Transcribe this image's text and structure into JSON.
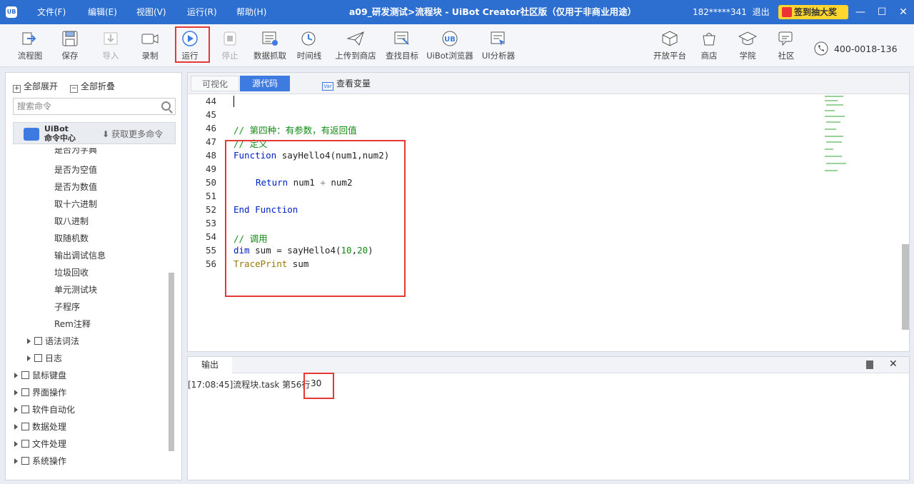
{
  "titlebar": {
    "logo": "UB",
    "menus": [
      "文件(F)",
      "编辑(E)",
      "视图(V)",
      "运行(R)",
      "帮助(H)"
    ],
    "title": "a09_研发测试>流程块 - UiBot Creator社区版（仅用于非商业用途）",
    "user": "182*****341",
    "logout": "退出",
    "promo": "签到抽大奖",
    "controls": [
      "—",
      "☐",
      "✕"
    ]
  },
  "toolbar": {
    "buttons": [
      {
        "label": "流程图",
        "icon": "flowchart-icon"
      },
      {
        "label": "保存",
        "icon": "save-icon"
      },
      {
        "label": "导入",
        "icon": "import-icon"
      },
      {
        "label": "录制",
        "icon": "record-icon"
      },
      {
        "label": "运行",
        "icon": "run-icon"
      },
      {
        "label": "停止",
        "icon": "stop-icon"
      },
      {
        "label": "数据抓取",
        "icon": "data-scrape-icon"
      },
      {
        "label": "时间线",
        "icon": "timeline-icon"
      },
      {
        "label": "上传到商店",
        "icon": "upload-icon"
      },
      {
        "label": "查找目标",
        "icon": "find-target-icon"
      },
      {
        "label": "UiBot浏览器",
        "icon": "browser-icon"
      },
      {
        "label": "UI分析器",
        "icon": "ui-analyzer-icon"
      },
      {
        "label": "开放平台",
        "icon": "open-platform-icon"
      },
      {
        "label": "商店",
        "icon": "store-icon"
      },
      {
        "label": "学院",
        "icon": "academy-icon"
      },
      {
        "label": "社区",
        "icon": "community-icon"
      }
    ],
    "phone": "400-0018-136"
  },
  "leftpanel": {
    "expand_all": "全部展开",
    "collapse_all": "全部折叠",
    "search_placeholder": "搜索命令",
    "cmd_center_line1": "UiBot",
    "cmd_center_line2": "命令中心",
    "more_commands": "获取更多命令",
    "leaf_items": [
      "是否为字典",
      "是否为空值",
      "是否为数值",
      "取十六进制",
      "取八进制",
      "取随机数",
      "输出调试信息",
      "垃圾回收",
      "单元测试块",
      "子程序",
      "Rem注释"
    ],
    "sub_groups": [
      "语法词法",
      "日志"
    ],
    "groups": [
      "鼠标键盘",
      "界面操作",
      "软件自动化",
      "数据处理",
      "文件处理",
      "系统操作"
    ]
  },
  "editor": {
    "tab_visual": "可视化",
    "tab_source": "源代码",
    "view_vars": "查看变量",
    "line_numbers": [
      "44",
      "45",
      "46",
      "47",
      "48",
      "49",
      "50",
      "51",
      "52",
      "53",
      "54",
      "55",
      "56"
    ],
    "code": {
      "l46": "// 第四种：有参数，有返回值",
      "l47": "// 定义",
      "l48_kw": "Function",
      "l48_rest": " sayHello4(num1,num2)",
      "l50_kw": "Return",
      "l50_a": " num1 ",
      "l50_op": "+",
      "l50_b": " num2",
      "l52": "End Function",
      "l54": "// 调用",
      "l55_kw": "dim",
      "l55_a": " sum = sayHello4(",
      "l55_n1": "10",
      "l55_c": ",",
      "l55_n2": "20",
      "l55_e": ")",
      "l56_fn": "TracePrint",
      "l56_rest": " sum"
    }
  },
  "output": {
    "tab": "输出",
    "log_prefix": "[17:08:45]流程块.task 第56行",
    "value": "30"
  }
}
